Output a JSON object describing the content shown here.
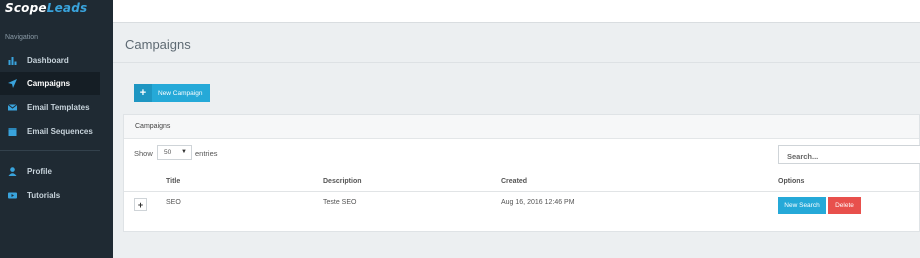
{
  "app": {
    "logo_part1": "Scope",
    "logo_part2": "Leads"
  },
  "sidebar": {
    "heading": "Navigation",
    "items": [
      {
        "label": "Dashboard",
        "icon": "bar-chart-icon"
      },
      {
        "label": "Campaigns",
        "icon": "paper-plane-icon",
        "active": true
      },
      {
        "label": "Email Templates",
        "icon": "envelope-icon"
      },
      {
        "label": "Email Sequences",
        "icon": "calendar-icon"
      },
      {
        "label": "Profile",
        "icon": "user-icon"
      },
      {
        "label": "Tutorials",
        "icon": "video-icon"
      }
    ]
  },
  "page": {
    "title": "Campaigns",
    "new_button_label": "New Campaign"
  },
  "panel": {
    "title": "Campaigns",
    "show_label": "Show",
    "page_size": "50",
    "entries_label": "entries",
    "search_placeholder": "Search...",
    "columns": [
      "Title",
      "Description",
      "Created",
      "Options"
    ],
    "rows": [
      {
        "expand": "+",
        "title": "SEO",
        "description": "Teste SEO",
        "created": "Aug 16, 2016 12:46 PM",
        "search_label": "New Search",
        "delete_label": "Delete"
      }
    ]
  },
  "colors": {
    "sidebar_bg": "#1f2a33",
    "accent": "#25a9d8",
    "danger": "#e8504c",
    "page_bg": "#eceff1"
  }
}
